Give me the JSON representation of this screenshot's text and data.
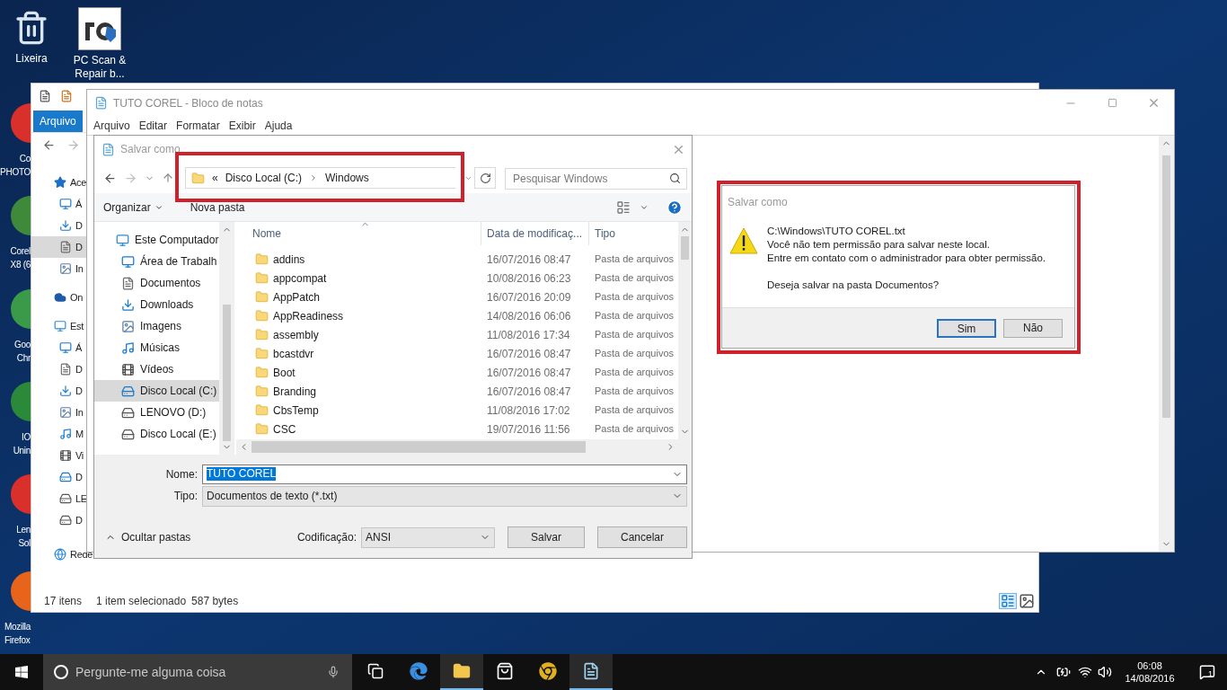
{
  "desktop_icons": [
    {
      "kind": "recycle-bin",
      "label": "Lixeira"
    },
    {
      "kind": "shortcut-app",
      "label": "PC Scan & Repair b..."
    }
  ],
  "covered_desktop_icons": [
    {
      "kind": "red",
      "lines": [
        "Co",
        "PHOTO"
      ]
    },
    {
      "kind": "green",
      "lines": [
        "Corel",
        "X8 (6"
      ]
    },
    {
      "kind": "chrome",
      "lines": [
        "Goo",
        "Chr"
      ]
    },
    {
      "kind": "io",
      "lines": [
        "IO",
        "Unin"
      ]
    },
    {
      "kind": "red",
      "lines": [
        "Len",
        "Sol"
      ]
    },
    {
      "kind": "firefox",
      "lines": [
        "Mozilla",
        "Firefox"
      ]
    }
  ],
  "explorer": {
    "ribbon_tab": "Arquivo",
    "nav": [
      {
        "label": "Ace",
        "kind": "star",
        "selected": false,
        "children": [
          {
            "label": "Á",
            "kind": "desktop",
            "selected": false
          },
          {
            "label": "D",
            "kind": "download",
            "selected": false
          },
          {
            "label": "D",
            "kind": "document",
            "selected": true
          },
          {
            "label": "In",
            "kind": "image",
            "selected": false
          }
        ]
      },
      {
        "label": "On",
        "kind": "cloud",
        "selected": false
      },
      {
        "label": "Est",
        "kind": "computer",
        "selected": false,
        "children": [
          {
            "label": "Á",
            "kind": "desktop",
            "selected": false
          },
          {
            "label": "D",
            "kind": "document",
            "selected": false
          },
          {
            "label": "D",
            "kind": "download",
            "selected": false
          },
          {
            "label": "In",
            "kind": "image",
            "selected": false
          },
          {
            "label": "M",
            "kind": "music",
            "selected": false
          },
          {
            "label": "Vi",
            "kind": "video",
            "selected": false
          },
          {
            "label": "D",
            "kind": "system-drive",
            "selected": false
          },
          {
            "label": "LE",
            "kind": "drive",
            "selected": false
          },
          {
            "label": "D",
            "kind": "drive",
            "selected": false
          }
        ]
      },
      {
        "label": "Rede",
        "kind": "network",
        "selected": false
      }
    ],
    "status": [
      "17 itens",
      "1 item selecionado",
      "587 bytes"
    ]
  },
  "notepad": {
    "title": "TUTO COREL - Bloco de notas",
    "menu": [
      "Arquivo",
      "Editar",
      "Formatar",
      "Exibir",
      "Ajuda"
    ]
  },
  "save_dialog": {
    "title": "Salvar como",
    "breadcrumb": {
      "overflow": "«",
      "parts": [
        "Disco Local (C:)",
        "Windows"
      ]
    },
    "search": {
      "placeholder": "Pesquisar Windows"
    },
    "toolbar": [
      "Organizar",
      "Nova pasta"
    ],
    "nav": [
      {
        "label": "Este Computador",
        "kind": "computer",
        "selected": false,
        "children": [
          {
            "label": "Área de Trabalh",
            "kind": "desktop",
            "selected": false
          },
          {
            "label": "Documentos",
            "kind": "document",
            "selected": false
          },
          {
            "label": "Downloads",
            "kind": "download",
            "selected": false
          },
          {
            "label": "Imagens",
            "kind": "image",
            "selected": false
          },
          {
            "label": "Músicas",
            "kind": "music",
            "selected": false
          },
          {
            "label": "Vídeos",
            "kind": "video",
            "selected": false
          },
          {
            "label": "Disco Local (C:)",
            "kind": "system-drive",
            "selected": true
          },
          {
            "label": "LENOVO (D:)",
            "kind": "drive",
            "selected": false
          },
          {
            "label": "Disco Local (E:)",
            "kind": "drive",
            "selected": false
          }
        ]
      }
    ],
    "columns": [
      "Nome",
      "Data de modificaç...",
      "Tipo"
    ],
    "rows": [
      [
        "addins",
        "16/07/2016 08:47",
        "Pasta de arquivos"
      ],
      [
        "appcompat",
        "10/08/2016 06:23",
        "Pasta de arquivos"
      ],
      [
        "AppPatch",
        "16/07/2016 20:09",
        "Pasta de arquivos"
      ],
      [
        "AppReadiness",
        "14/08/2016 06:06",
        "Pasta de arquivos"
      ],
      [
        "assembly",
        "11/08/2016 17:34",
        "Pasta de arquivos"
      ],
      [
        "bcastdvr",
        "16/07/2016 08:47",
        "Pasta de arquivos"
      ],
      [
        "Boot",
        "16/07/2016 08:47",
        "Pasta de arquivos"
      ],
      [
        "Branding",
        "16/07/2016 08:47",
        "Pasta de arquivos"
      ],
      [
        "CbsTemp",
        "11/08/2016 17:02",
        "Pasta de arquivos"
      ],
      [
        "CSC",
        "19/07/2016 11:56",
        "Pasta de arquivos"
      ]
    ],
    "name_label": "Nome:",
    "name_value": "TUTO COREL",
    "type_label": "Tipo:",
    "type_value": "Documentos de texto (*.txt)",
    "hide_folders": "Ocultar pastas",
    "encoding_label": "Codificação:",
    "encoding_value": "ANSI",
    "buttons": [
      "Salvar",
      "Cancelar"
    ]
  },
  "alert": {
    "title": "Salvar como",
    "lines": [
      "C:\\Windows\\TUTO COREL.txt",
      "Você não tem permissão para salvar neste local.",
      "Entre em contato com o administrador para obter permissão."
    ],
    "question": "Deseja salvar na pasta Documentos?",
    "buttons": [
      {
        "label": "Sim",
        "default": true
      },
      {
        "label": "Não",
        "default": false
      }
    ]
  },
  "taskbar": {
    "search_placeholder": "Pergunte-me alguma coisa",
    "apps": [
      {
        "kind": "task-view",
        "active": false
      },
      {
        "kind": "edge",
        "active": false
      },
      {
        "kind": "explorer",
        "active": true
      },
      {
        "kind": "store",
        "active": false
      },
      {
        "kind": "chrome",
        "active": false
      },
      {
        "kind": "notepad",
        "active": true
      }
    ],
    "time": "06:08",
    "date": "14/08/2016",
    "notifications": "1"
  }
}
